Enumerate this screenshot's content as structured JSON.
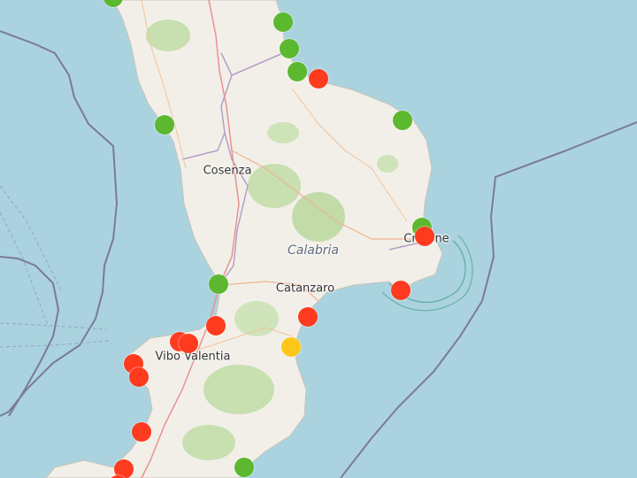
{
  "map": {
    "places": {
      "cosenza": "Cosenza",
      "calabria": "Calabria",
      "catanzaro": "Catanzaro",
      "crotone": "Crotone",
      "vibo_valentia": "Vibo Valentia"
    },
    "status_colors": {
      "green": "#5cb82e",
      "red": "#ff3b1f",
      "yellow": "#ffc61a"
    },
    "markers": [
      {
        "id": "m1",
        "status": "green"
      },
      {
        "id": "m2",
        "status": "green"
      },
      {
        "id": "m3",
        "status": "green"
      },
      {
        "id": "m4",
        "status": "green"
      },
      {
        "id": "m5",
        "status": "red"
      },
      {
        "id": "m6",
        "status": "green"
      },
      {
        "id": "m7",
        "status": "green"
      },
      {
        "id": "m8",
        "status": "green"
      },
      {
        "id": "m9",
        "status": "red"
      },
      {
        "id": "m10",
        "status": "red"
      },
      {
        "id": "m11",
        "status": "green"
      },
      {
        "id": "m12",
        "status": "red"
      },
      {
        "id": "m13",
        "status": "red"
      },
      {
        "id": "m14",
        "status": "yellow"
      },
      {
        "id": "m15",
        "status": "red"
      },
      {
        "id": "m16",
        "status": "red"
      },
      {
        "id": "m17",
        "status": "red"
      },
      {
        "id": "m18",
        "status": "red"
      },
      {
        "id": "m19",
        "status": "red"
      },
      {
        "id": "m20",
        "status": "red"
      },
      {
        "id": "m21",
        "status": "red"
      },
      {
        "id": "m22",
        "status": "green"
      }
    ]
  }
}
